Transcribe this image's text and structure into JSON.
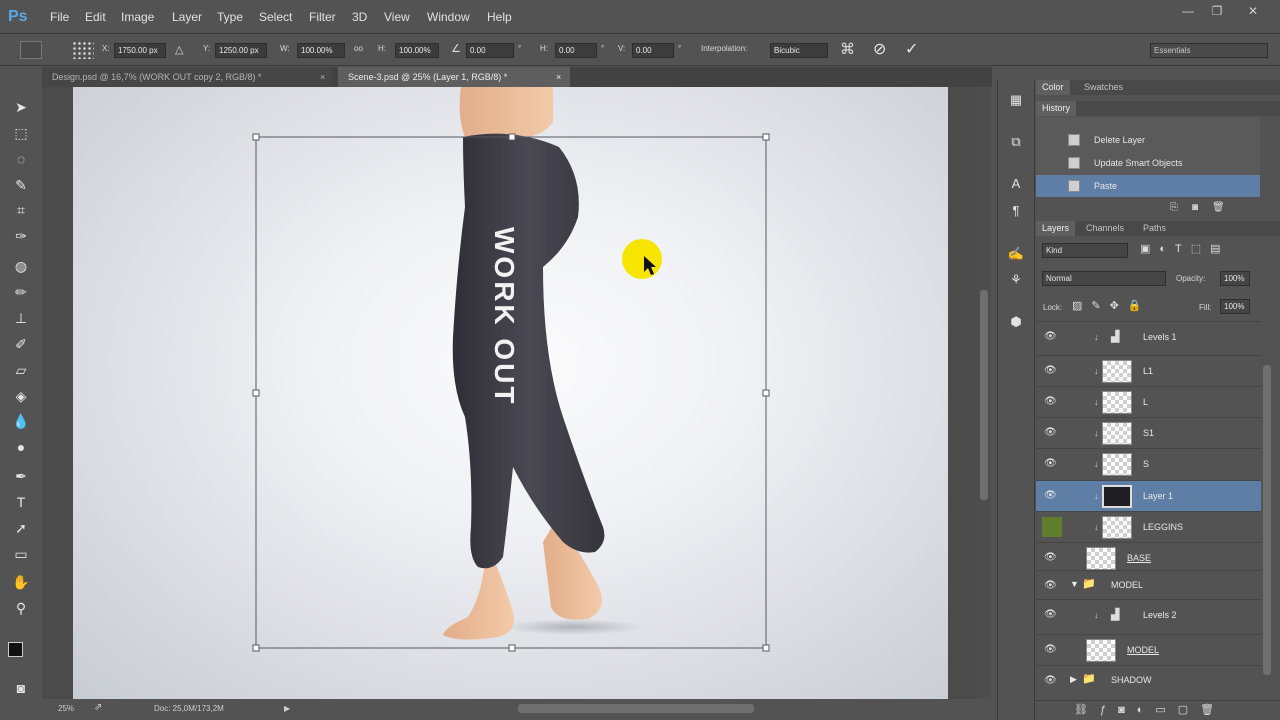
{
  "app": {
    "logo": "Ps",
    "accent": "#5aa9e6"
  },
  "menu": [
    "File",
    "Edit",
    "Image",
    "Layer",
    "Type",
    "Select",
    "Filter",
    "3D",
    "View",
    "Window",
    "Help"
  ],
  "window_controls": {
    "minimize": "—",
    "restore": "❐",
    "close": "✕"
  },
  "options": {
    "x_label": "X:",
    "x_value": "1750.00 px",
    "y_label": "Y:",
    "y_value": "1250.00 px",
    "w_label": "W:",
    "w_value": "100.00%",
    "link_label": "oo",
    "h_label": "H:",
    "h_value": "100.00%",
    "angle_value": "0.00",
    "deg": "°",
    "hskew_label": "H:",
    "hskew_value": "0.00",
    "vskew_label": "V:",
    "vskew_value": "0.00",
    "interp_label": "Interpolation:",
    "interp_value": "Bicubic",
    "workspace": "Essentials"
  },
  "tabs": [
    {
      "label": "Design.psd @ 16,7% (WORK OUT copy 2, RGB/8) *",
      "close": "×"
    },
    {
      "label": "Scene-3.psd @ 25% (Layer 1, RGB/8) *",
      "close": "×"
    }
  ],
  "canvas": {
    "leggings_text": "WORK OUT"
  },
  "status": {
    "zoom": "25%",
    "doc": "Doc: 25,0M/173,2M",
    "arrow": "▶"
  },
  "color_panel": {
    "tabs": [
      "Color",
      "Swatches"
    ]
  },
  "history_panel": {
    "title": "History",
    "items": [
      "Delete Layer",
      "Update Smart Objects",
      "Paste"
    ]
  },
  "layers_panel": {
    "tabs": [
      "Layers",
      "Channels",
      "Paths"
    ],
    "kind": "Kind",
    "blend_mode": "Normal",
    "opacity_label": "Opacity:",
    "opacity_value": "100%",
    "lock_label": "Lock:",
    "fill_label": "Fill:",
    "fill_value": "100%",
    "layers": [
      "Levels 1",
      "L1",
      "L",
      "S1",
      "S",
      "Layer 1",
      "LEGGINS",
      "BASE",
      "MODEL",
      "Levels 2",
      "MODEL",
      "SHADOW"
    ]
  },
  "colors": {
    "selection": "#5f7ea6",
    "cursor_highlight": "#f5e500",
    "leggings": "#3e3d46"
  }
}
